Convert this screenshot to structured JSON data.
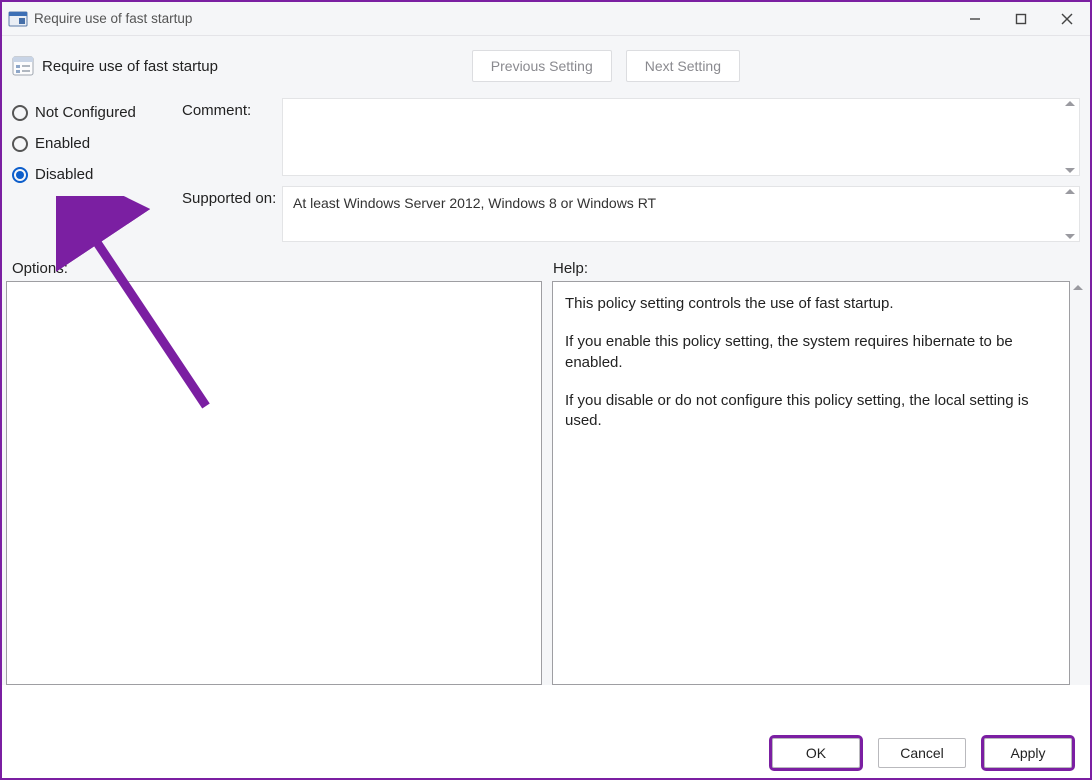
{
  "window": {
    "title": "Require use of fast startup"
  },
  "header": {
    "policy_title": "Require use of fast startup",
    "prev_label": "Previous Setting",
    "next_label": "Next Setting"
  },
  "radios": {
    "not_configured": "Not Configured",
    "enabled": "Enabled",
    "disabled": "Disabled",
    "selected": "disabled"
  },
  "fields": {
    "comment_label": "Comment:",
    "comment_value": "",
    "supported_label": "Supported on:",
    "supported_value": "At least Windows Server 2012, Windows 8 or Windows RT"
  },
  "section_labels": {
    "options": "Options:",
    "help": "Help:"
  },
  "help": {
    "p1": "This policy setting controls the use of fast startup.",
    "p2": "If you enable this policy setting, the system requires hibernate to be enabled.",
    "p3": "If you disable or do not configure this policy setting, the local setting is used."
  },
  "footer": {
    "ok": "OK",
    "cancel": "Cancel",
    "apply": "Apply"
  }
}
